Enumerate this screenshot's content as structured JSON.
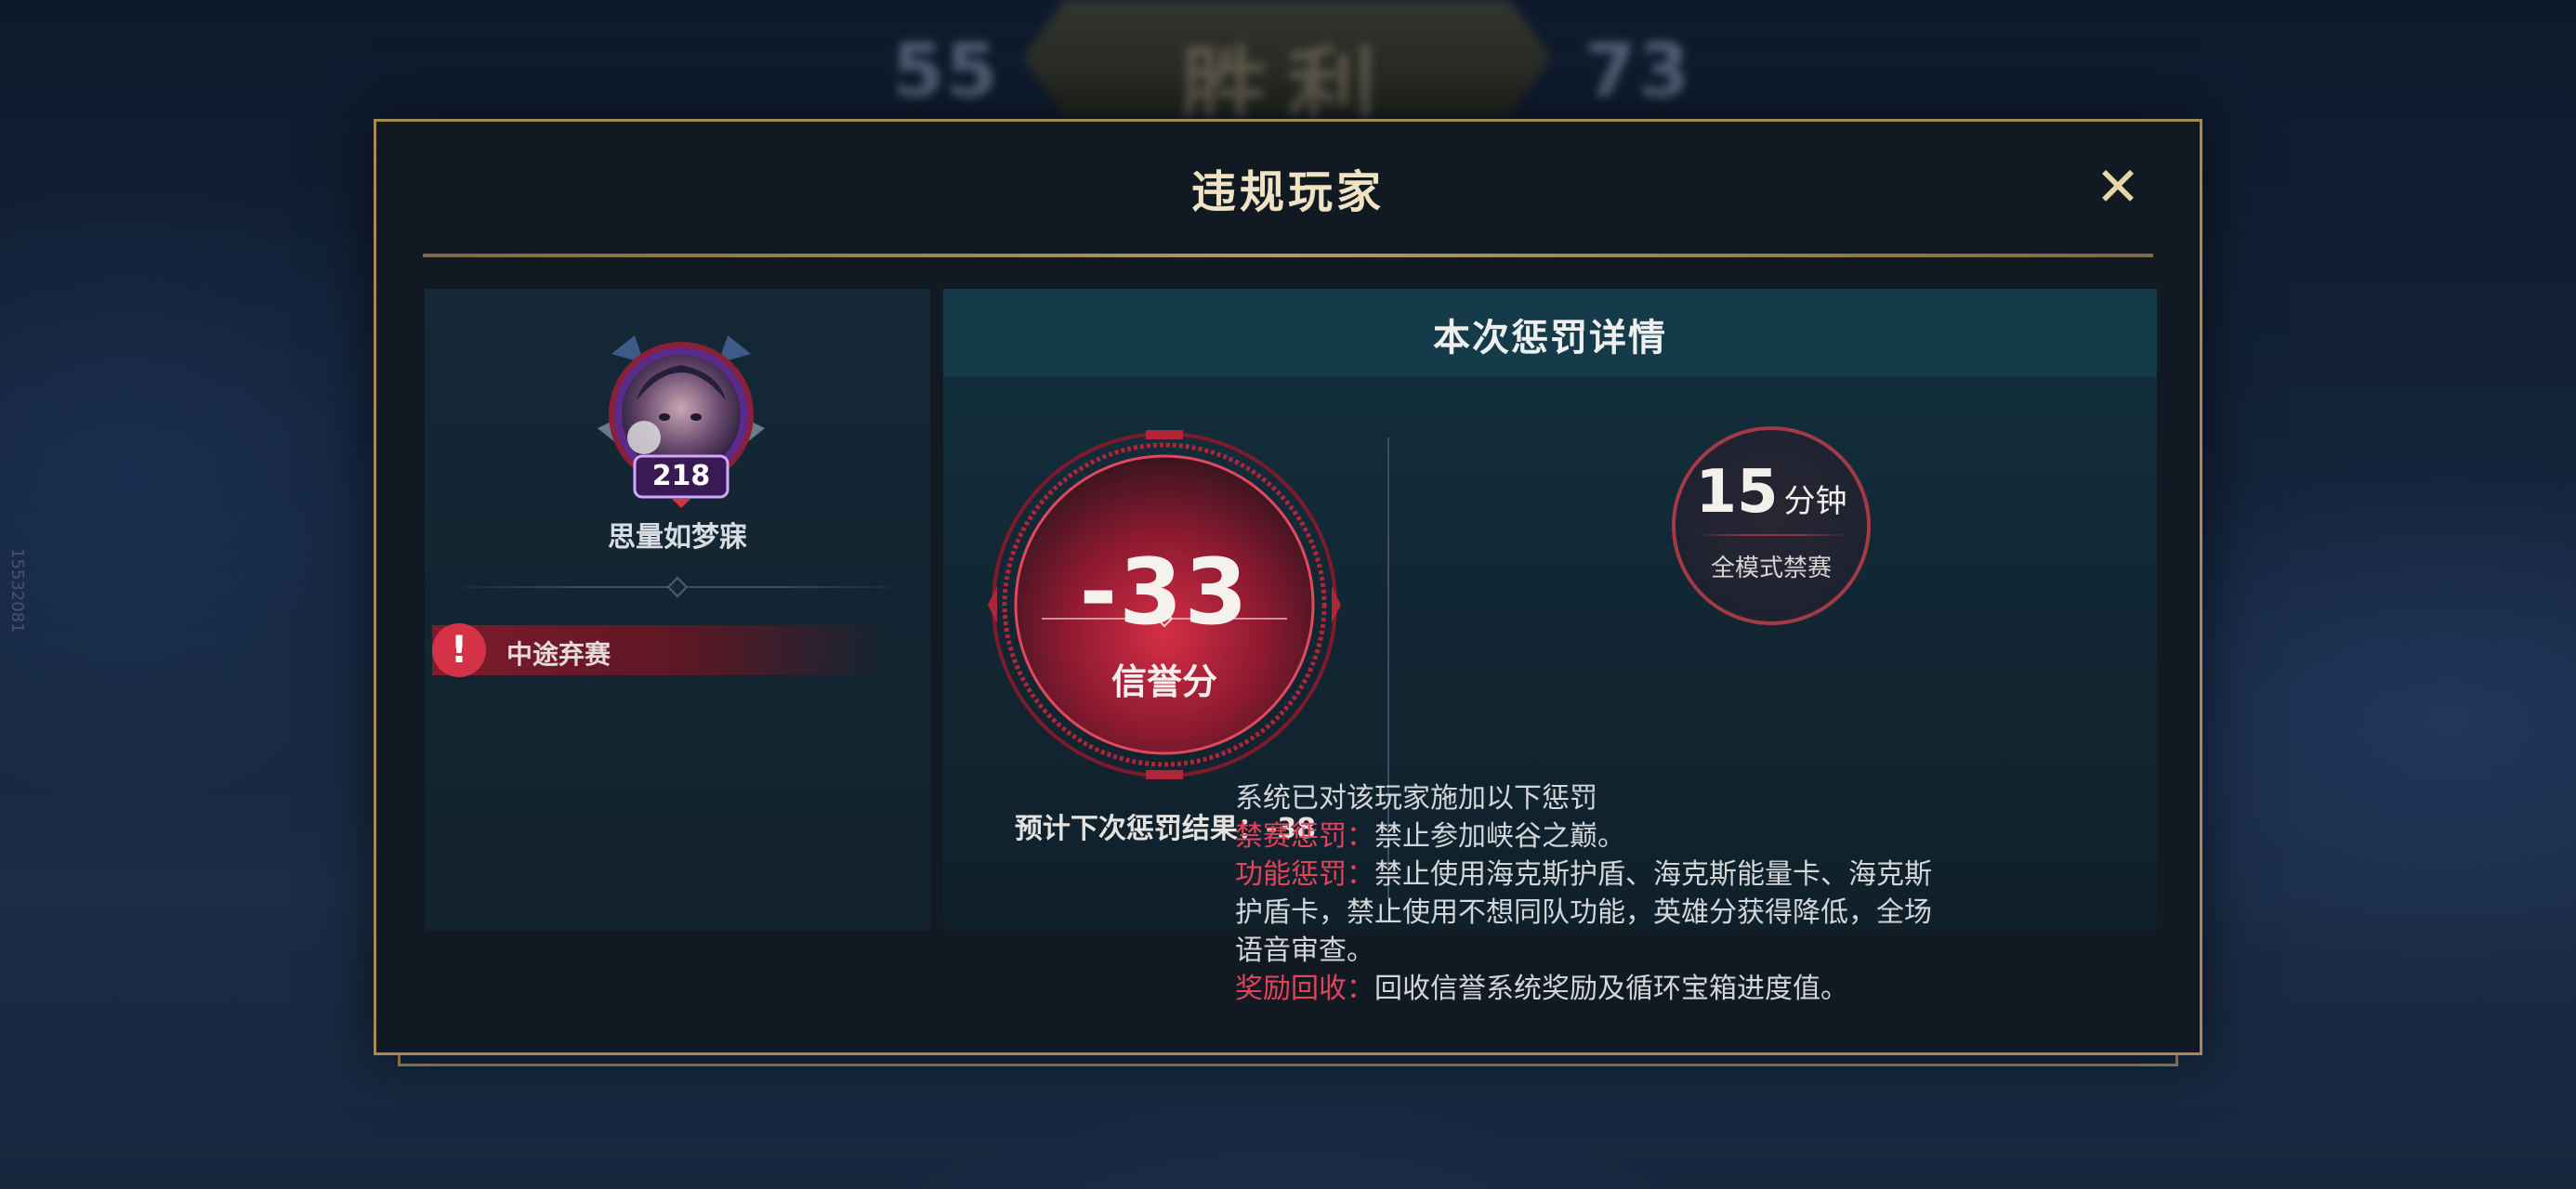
{
  "background": {
    "score_left": "55",
    "result": "胜利",
    "score_right": "73",
    "side_text": "15532081"
  },
  "modal": {
    "title": "违规玩家",
    "close_icon": "close-x-icon"
  },
  "player": {
    "name": "思量如梦寐",
    "level": "218",
    "violation": {
      "icon": "exclamation-icon",
      "label": "中途弃赛"
    }
  },
  "penalty": {
    "header": "本次惩罚详情",
    "credit_change": "-33",
    "credit_label": "信誉分",
    "forecast": "预计下次惩罚结果：-38",
    "ban": {
      "minutes": "15",
      "unit": "分钟",
      "scope": "全模式禁赛"
    },
    "details": {
      "intro": "系统已对该玩家施加以下惩罚",
      "items": [
        {
          "label": "禁赛惩罚：",
          "text": "禁止参加峡谷之巅。"
        },
        {
          "label": "功能惩罚：",
          "text": "禁止使用海克斯护盾、海克斯能量卡、海克斯护盾卡，禁止使用不想同队功能，英雄分获得降低，全场语音审查。"
        },
        {
          "label": "奖励回收：",
          "text": "回收信誉系统奖励及循环宝箱进度值。"
        }
      ]
    }
  },
  "colors": {
    "gold_border": "#a58a52",
    "penalty_red": "#e2455a",
    "ring_red": "#c7283d"
  }
}
